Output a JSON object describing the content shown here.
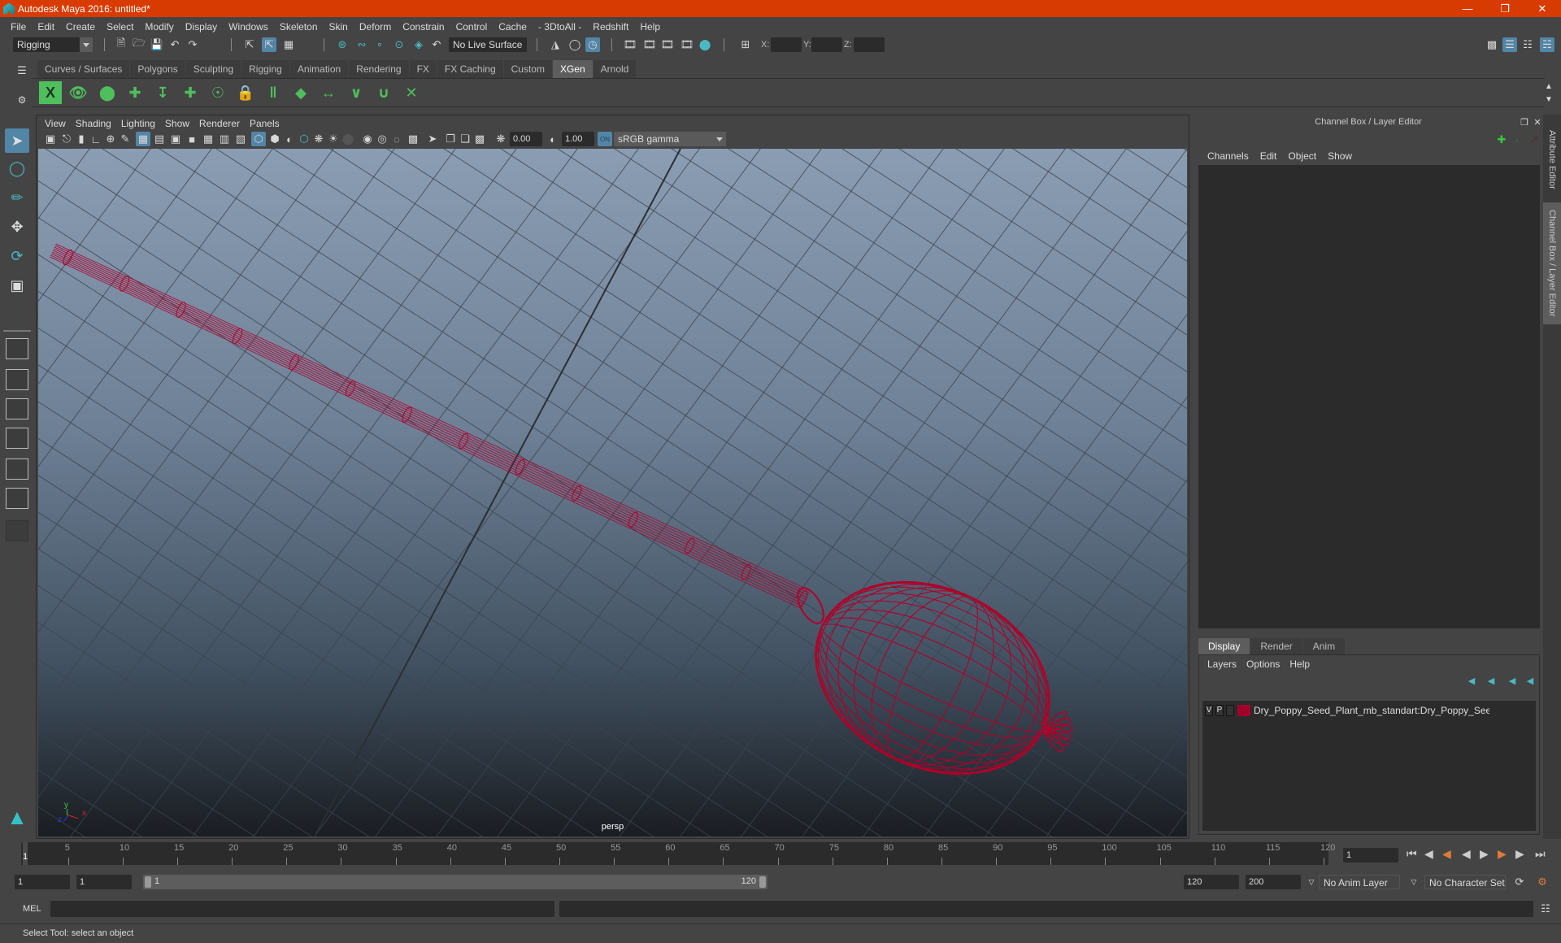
{
  "window": {
    "title": "Autodesk Maya 2016: untitled*",
    "controls": [
      "minimize",
      "restore",
      "close"
    ]
  },
  "menubar": [
    "File",
    "Edit",
    "Create",
    "Select",
    "Modify",
    "Display",
    "Windows",
    "Skeleton",
    "Skin",
    "Deform",
    "Constrain",
    "Control",
    "Cache",
    "- 3DtoAll -",
    "Redshift",
    "Help"
  ],
  "statusline": {
    "menuset": "Rigging",
    "live_surface": "No Live Surface",
    "x_label": "X:",
    "y_label": "Y:",
    "z_label": "Z:",
    "x_value": "",
    "y_value": "",
    "z_value": ""
  },
  "shelf": {
    "tabs": [
      "Curves / Surfaces",
      "Polygons",
      "Sculpting",
      "Rigging",
      "Animation",
      "Rendering",
      "FX",
      "FX Caching",
      "Custom",
      "XGen",
      "Arnold"
    ],
    "active_tab": "XGen",
    "icons": [
      "xgen-editor-icon",
      "xgen-preview-icon",
      "xgen-clear-preview-icon",
      "add-guides-icon",
      "sculpt-guides-icon",
      "insert-guide-icon",
      "toggle-guide-visibility-icon",
      "lock-guide-icon",
      "guide-length-icon",
      "guide-surface-icon",
      "grooming-icon",
      "flip-guide-icon",
      "select-guides-icon",
      "bend-guides-icon",
      "reset-guides-icon"
    ]
  },
  "viewport": {
    "menu": [
      "View",
      "Shading",
      "Lighting",
      "Show",
      "Renderer",
      "Panels"
    ],
    "exposure": "0.00",
    "gamma": "1.00",
    "color_management": "ON",
    "view_transform": "sRGB gamma",
    "camera": "persp",
    "wireframe_color": "#b0002a",
    "axis": {
      "x": "x",
      "y": "y",
      "z": "z"
    }
  },
  "channel_box": {
    "title": "Channel Box / Layer Editor",
    "menu": [
      "Channels",
      "Edit",
      "Object",
      "Show"
    ],
    "layer_tabs": [
      "Display",
      "Render",
      "Anim"
    ],
    "active_layer_tab": "Display",
    "layer_menu": [
      "Layers",
      "Options",
      "Help"
    ],
    "layers": [
      {
        "visible": "V",
        "playback": "P",
        "color": "#a0002a",
        "name": "Dry_Poppy_Seed_Plant_mb_standart:Dry_Poppy_Seed_Pla"
      }
    ]
  },
  "side_tabs": [
    "Attribute Editor",
    "Channel Box / Layer Editor"
  ],
  "timeline": {
    "start": 1,
    "end": 120,
    "current_frame": "1",
    "tick_labels": [
      "5",
      "10",
      "15",
      "20",
      "25",
      "30",
      "35",
      "40",
      "45",
      "50",
      "55",
      "60",
      "65",
      "70",
      "75",
      "80",
      "85",
      "90",
      "95",
      "100",
      "105",
      "110",
      "115",
      "120"
    ],
    "current_frame_field": "1"
  },
  "range": {
    "start_field": "1",
    "playback_start": "1",
    "slider_start": "1",
    "slider_end": "120",
    "playback_end": "120",
    "end_field": "200",
    "anim_layer": "No Anim Layer",
    "character_set": "No Character Set"
  },
  "command_line": {
    "label": "MEL",
    "input": "",
    "result": ""
  },
  "help_line": "Select Tool: select an object"
}
